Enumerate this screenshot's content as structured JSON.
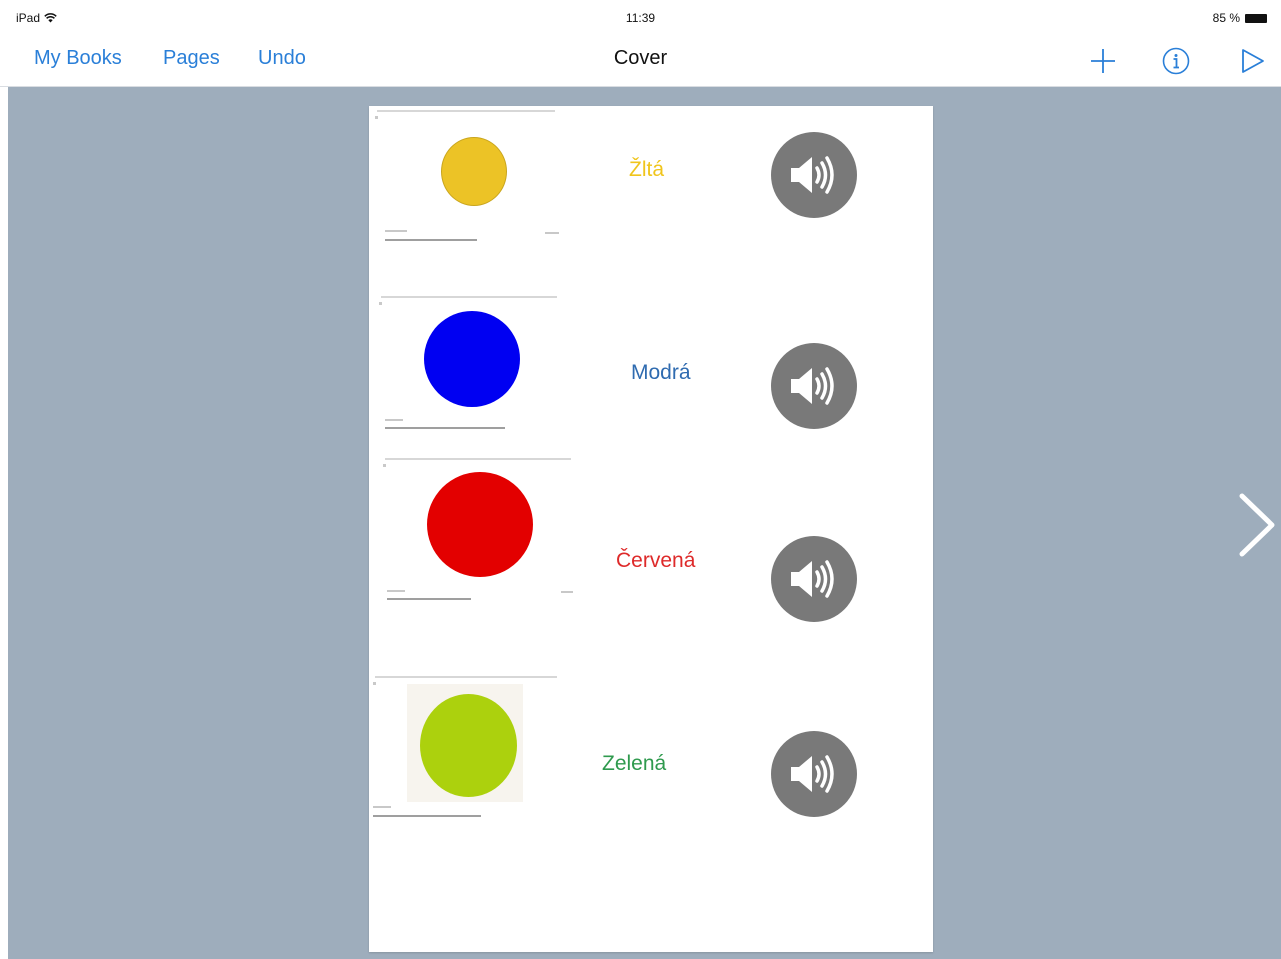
{
  "status_bar": {
    "device": "iPad",
    "time": "11:39",
    "battery": "85 %"
  },
  "navbar": {
    "my_books": "My Books",
    "pages": "Pages",
    "undo": "Undo",
    "title": "Cover",
    "icons": [
      "add-icon",
      "info-icon",
      "play-icon"
    ]
  },
  "page": {
    "rows": [
      {
        "label": "Žltá",
        "color": "#ecc326",
        "label_color": "#f0c51c"
      },
      {
        "label": "Modrá",
        "color": "#0000f2",
        "label_color": "#2f6bb0"
      },
      {
        "label": "Červená",
        "color": "#e30000",
        "label_color": "#de2a2a"
      },
      {
        "label": "Zelená",
        "color": "#acd10d",
        "label_color": "#2f9a4e"
      }
    ],
    "sound_icon": "speaker-icon"
  },
  "colors": {
    "accent": "#2a7fd8",
    "canvas_bg": "#9eadbc",
    "sound_button": "#797979"
  }
}
